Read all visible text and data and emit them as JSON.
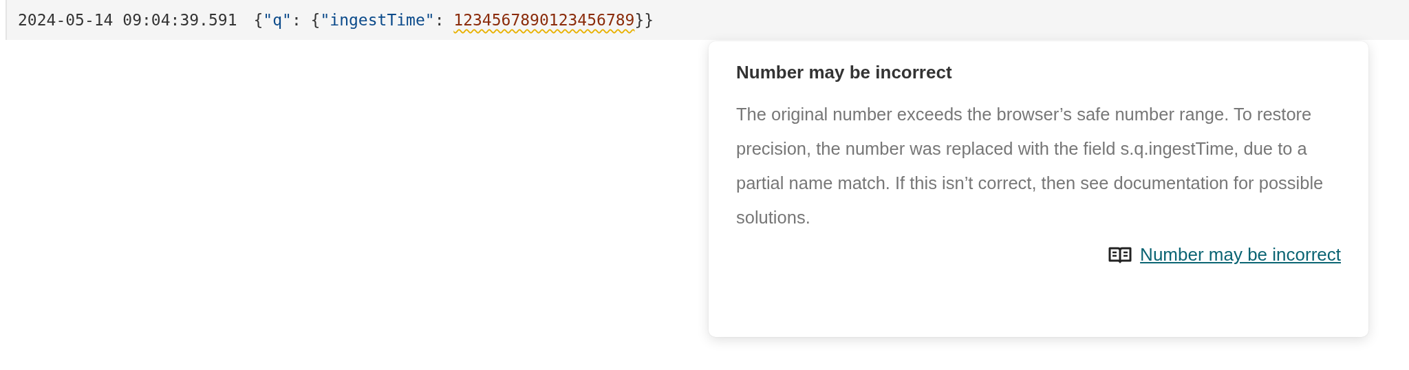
{
  "log_row": {
    "timestamp": "2024-05-14 09:04:39.591",
    "message": [
      {
        "kind": "punct",
        "text": "{"
      },
      {
        "kind": "key",
        "text": "\"q\""
      },
      {
        "kind": "punct",
        "text": ": {"
      },
      {
        "kind": "key",
        "text": "\"ingestTime\""
      },
      {
        "kind": "punct",
        "text": ": "
      },
      {
        "kind": "number",
        "text": "1234567890123456789",
        "warning": true
      },
      {
        "kind": "punct",
        "text": "}}"
      }
    ]
  },
  "tooltip": {
    "title": "Number may be incorrect",
    "body": "The original number exceeds the browser’s safe number range. To restore precision, the number was replaced with the field s.q.ingestTime, due to a partial name match. If this isn’t correct, then see documentation for possible solutions.",
    "link": "Number may be incorrect"
  }
}
